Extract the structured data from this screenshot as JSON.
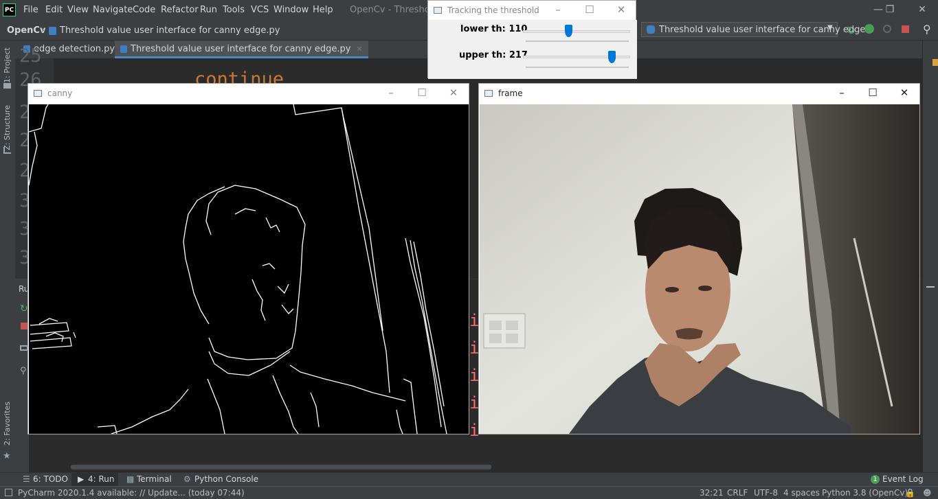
{
  "menubar": {
    "logo": "PC",
    "items": [
      "File",
      "Edit",
      "View",
      "Navigate",
      "Code",
      "Refactor",
      "Run",
      "Tools",
      "VCS",
      "Window",
      "Help"
    ],
    "window_title": "OpenCv - Threshold v"
  },
  "navbar": {
    "project": "OpenCv",
    "file": "Threshold value user interface for canny edge.py",
    "run_config": "Threshold value user interface for canny edge"
  },
  "tabs": [
    {
      "label": "edge detection.py"
    },
    {
      "label": "Threshold value user interface for canny edge.py"
    }
  ],
  "editor": {
    "line_numbers": [
      "25",
      "26",
      "2",
      "2",
      "2",
      "3",
      "3",
      "3"
    ],
    "code_fragment": "continue"
  },
  "left_tools": {
    "project": "1: Project",
    "structure": "Z: Structure",
    "favorites": "2: Favorites",
    "run_label": "Ru"
  },
  "run_output_chars": [
    "i",
    "i",
    "i",
    "i",
    "i"
  ],
  "bottom_tools": [
    {
      "label": "6: TODO",
      "icon": "list-icon"
    },
    {
      "label": "4: Run",
      "icon": "play-icon"
    },
    {
      "label": "Terminal",
      "icon": "terminal-icon"
    },
    {
      "label": "Python Console",
      "icon": "python-icon"
    }
  ],
  "event_log": {
    "count": "1",
    "label": "Event Log"
  },
  "statusbar": {
    "message": "PyCharm 2020.1.4 available: // Update... (today 07:44)",
    "position": "32:21",
    "line_sep": "CRLF",
    "encoding": "UTF-8",
    "indent": "4 spaces",
    "interpreter": "Python 3.8 (OpenCv)"
  },
  "trackbar_window": {
    "title": "Tracking the threshold",
    "lower": {
      "label": "lower th: 110",
      "value": 110,
      "max": 255
    },
    "upper": {
      "label": "upper th: 217",
      "value": 217,
      "max": 255
    }
  },
  "canny_window": {
    "title": "canny"
  },
  "frame_window": {
    "title": "frame"
  },
  "colors": {
    "ide_bg": "#2b2b2b",
    "ide_chrome": "#3c3f41",
    "accent_blue": "#0078d7",
    "run_error": "#ff6b68"
  }
}
